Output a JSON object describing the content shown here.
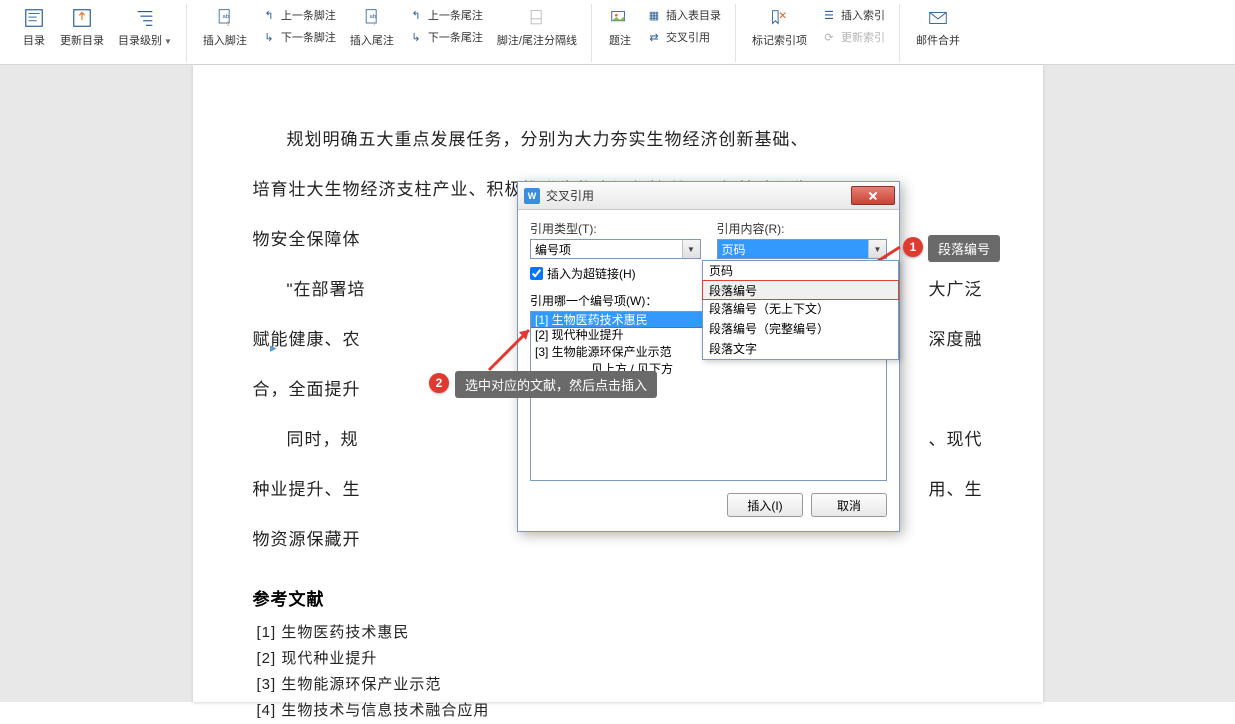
{
  "ribbon": {
    "toc": {
      "label": "目录"
    },
    "update_toc": {
      "label": "更新目录"
    },
    "toc_level": {
      "label": "目录级别"
    },
    "insert_footnote": {
      "label": "插入脚注"
    },
    "prev_footnote": "上一条脚注",
    "next_footnote": "下一条脚注",
    "insert_endnote": {
      "label": "插入尾注"
    },
    "prev_endnote": "上一条尾注",
    "next_endnote": "下一条尾注",
    "separator": {
      "label": "脚注/尾注分隔线"
    },
    "caption": {
      "label": "题注"
    },
    "insert_table_toc": "插入表目录",
    "cross_ref": "交叉引用",
    "mark_index": {
      "label": "标记索引项"
    },
    "insert_index": "插入索引",
    "update_index": "更新索引",
    "mail_merge": {
      "label": "邮件合并"
    }
  },
  "doc": {
    "p1": "规划明确五大重点发展任务，分别为大力夯实生物经济创新基础、",
    "p2": "培育壮大生物经济支柱产业、积极推进生物资源保护利用、加快建设生",
    "p3": "物安全保障体",
    "p4_a": "\"在部署培",
    "p4_b": "大广泛",
    "p5_a": "赋能健康、农",
    "p5_b": "深度融",
    "p6": "合，全面提升",
    "p7_a": "同时，规",
    "p7_b": "、现代",
    "p8": "种业提升、生",
    "p8_b": "用、生",
    "p9": "物资源保藏开",
    "ref_title": "参考文献",
    "refs": [
      "[1]  生物医药技术惠民",
      "[2]  现代种业提升",
      "[3]  生物能源环保产业示范",
      "[4]  生物技术与信息技术融合应用"
    ]
  },
  "dialog": {
    "title": "交叉引用",
    "ref_type_label": "引用类型(T):",
    "ref_type_value": "编号项",
    "ref_content_label": "引用内容(R):",
    "ref_content_value": "页码",
    "hyperlink": "插入为超链接(H)",
    "which_label": "引用哪一个编号项(W)：",
    "items": [
      "[1] 生物医药技术惠民",
      "[2] 现代种业提升",
      "[3] 生物能源环保产业示范",
      "见上方 / 见下方"
    ],
    "content_options": [
      "页码",
      "段落编号",
      "段落编号（无上下文）",
      "段落编号（完整编号）",
      "段落文字"
    ],
    "insert_btn": "插入(I)",
    "cancel_btn": "取消"
  },
  "callouts": {
    "c1_num": "1",
    "c1_text": "段落编号",
    "c2_num": "2",
    "c2_text": "选中对应的文献，然后点击插入"
  }
}
